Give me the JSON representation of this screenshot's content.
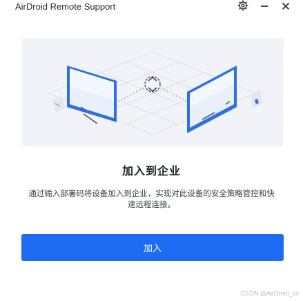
{
  "window": {
    "title": "AirDroid Remote Support"
  },
  "titlebar_icons": {
    "settings": "gear-icon",
    "minimize": "minimize-icon",
    "close": "close-icon"
  },
  "main": {
    "heading": "加入到企业",
    "description": "通过输入部署码将设备加入到企业，实现对此设备的安全策略管控和快速远程连接。",
    "join_button_label": "加入"
  },
  "watermark": "CSDN @AirDroid_cn",
  "colors": {
    "accent": "#1d6cf3",
    "card_background": "#f1f3f8",
    "device_blue": "#2f6fe0"
  }
}
